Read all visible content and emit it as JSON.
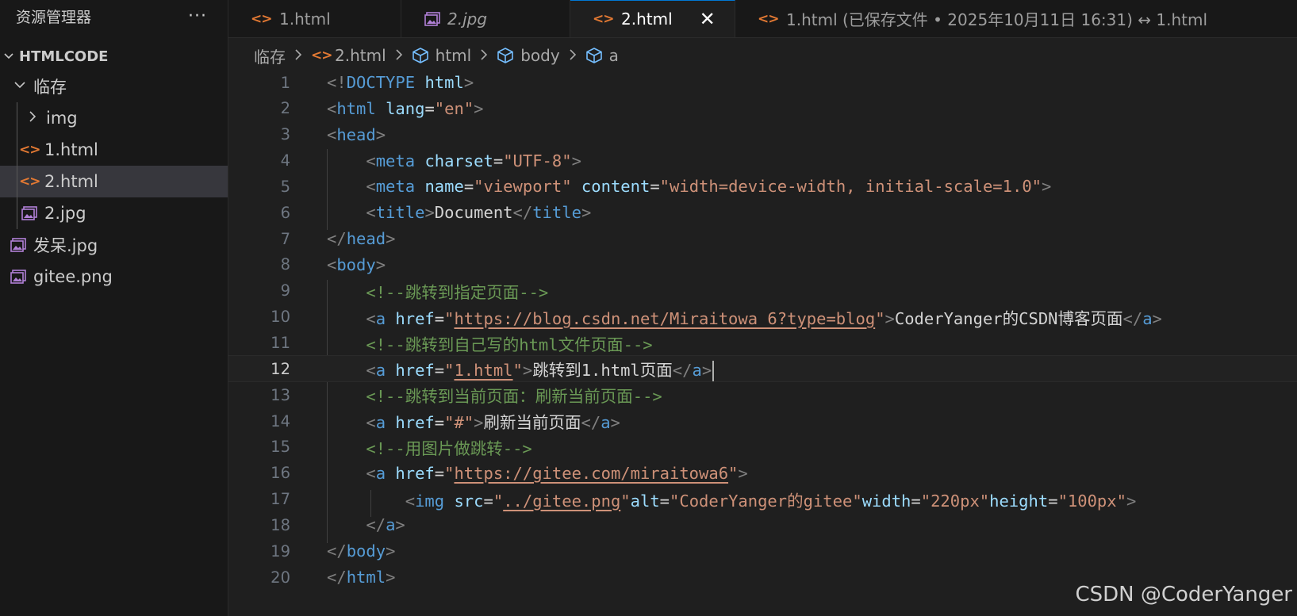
{
  "sidebar": {
    "title": "资源管理器",
    "more": "···",
    "root": "HTMLCODE",
    "items": [
      {
        "label": "临存",
        "kind": "folder-open"
      },
      {
        "label": "img",
        "kind": "folder"
      },
      {
        "label": "1.html",
        "kind": "html"
      },
      {
        "label": "2.html",
        "kind": "html",
        "selected": true
      },
      {
        "label": "2.jpg",
        "kind": "image"
      },
      {
        "label": "发呆.jpg",
        "kind": "image"
      },
      {
        "label": "gitee.png",
        "kind": "image"
      }
    ]
  },
  "tabs": [
    {
      "label": "1.html",
      "kind": "html"
    },
    {
      "label": "2.jpg",
      "kind": "image"
    },
    {
      "label": "2.html",
      "kind": "html",
      "active": true
    },
    {
      "label": "1.html (已保存文件 • 2025年10月11日 16:31) ↔ 1.html",
      "kind": "html"
    }
  ],
  "tab_close": "✕",
  "breadcrumb": [
    "临存",
    "2.html",
    "html",
    "body",
    "a"
  ],
  "code": {
    "current_line": 12,
    "line_numbers": [
      "1",
      "2",
      "3",
      "4",
      "5",
      "6",
      "7",
      "8",
      "9",
      "10",
      "11",
      "12",
      "13",
      "14",
      "15",
      "16",
      "17",
      "18",
      "19",
      "20"
    ],
    "lines": [
      [
        [
          "p",
          "<!"
        ],
        [
          "t",
          "DOCTYPE"
        ],
        [
          "x",
          " "
        ],
        [
          "a",
          "html"
        ],
        [
          "p",
          ">"
        ]
      ],
      [
        [
          "p",
          "<"
        ],
        [
          "t",
          "html"
        ],
        [
          "x",
          " "
        ],
        [
          "a",
          "lang"
        ],
        [
          "x",
          "="
        ],
        [
          "s",
          "\"en\""
        ],
        [
          "p",
          ">"
        ]
      ],
      [
        [
          "p",
          "<"
        ],
        [
          "t",
          "head"
        ],
        [
          "p",
          ">"
        ]
      ],
      [
        [
          "x",
          "    "
        ],
        [
          "p",
          "<"
        ],
        [
          "t",
          "meta"
        ],
        [
          "x",
          " "
        ],
        [
          "a",
          "charset"
        ],
        [
          "x",
          "="
        ],
        [
          "s",
          "\"UTF-8\""
        ],
        [
          "p",
          ">"
        ]
      ],
      [
        [
          "x",
          "    "
        ],
        [
          "p",
          "<"
        ],
        [
          "t",
          "meta"
        ],
        [
          "x",
          " "
        ],
        [
          "a",
          "name"
        ],
        [
          "x",
          "="
        ],
        [
          "s",
          "\"viewport\""
        ],
        [
          "x",
          " "
        ],
        [
          "a",
          "content"
        ],
        [
          "x",
          "="
        ],
        [
          "s",
          "\"width=device-width, initial-scale=1.0\""
        ],
        [
          "p",
          ">"
        ]
      ],
      [
        [
          "x",
          "    "
        ],
        [
          "p",
          "<"
        ],
        [
          "t",
          "title"
        ],
        [
          "p",
          ">"
        ],
        [
          "x",
          "Document"
        ],
        [
          "p",
          "</"
        ],
        [
          "t",
          "title"
        ],
        [
          "p",
          ">"
        ]
      ],
      [
        [
          "p",
          "</"
        ],
        [
          "t",
          "head"
        ],
        [
          "p",
          ">"
        ]
      ],
      [
        [
          "p",
          "<"
        ],
        [
          "t",
          "body"
        ],
        [
          "p",
          ">"
        ]
      ],
      [
        [
          "x",
          "    "
        ],
        [
          "c",
          "<!--跳转到指定页面-->"
        ]
      ],
      [
        [
          "x",
          "    "
        ],
        [
          "p",
          "<"
        ],
        [
          "t",
          "a"
        ],
        [
          "x",
          " "
        ],
        [
          "a",
          "href"
        ],
        [
          "x",
          "="
        ],
        [
          "s",
          "\""
        ],
        [
          "u",
          "https://blog.csdn.net/Miraitowa_6?type=blog"
        ],
        [
          "s",
          "\""
        ],
        [
          "p",
          ">"
        ],
        [
          "x",
          "CoderYanger的CSDN博客页面"
        ],
        [
          "p",
          "</"
        ],
        [
          "t",
          "a"
        ],
        [
          "p",
          ">"
        ]
      ],
      [
        [
          "x",
          "    "
        ],
        [
          "c",
          "<!--跳转到自己写的html文件页面-->"
        ]
      ],
      [
        [
          "x",
          "    "
        ],
        [
          "p",
          "<"
        ],
        [
          "t",
          "a"
        ],
        [
          "x",
          " "
        ],
        [
          "a",
          "href"
        ],
        [
          "x",
          "="
        ],
        [
          "s",
          "\""
        ],
        [
          "u",
          "1.html"
        ],
        [
          "s",
          "\""
        ],
        [
          "p",
          ">"
        ],
        [
          "x",
          "跳转到1.html页面"
        ],
        [
          "p",
          "</"
        ],
        [
          "t",
          "a"
        ],
        [
          "p",
          ">"
        ]
      ],
      [
        [
          "x",
          "    "
        ],
        [
          "c",
          "<!--跳转到当前页面：刷新当前页面-->"
        ]
      ],
      [
        [
          "x",
          "    "
        ],
        [
          "p",
          "<"
        ],
        [
          "t",
          "a"
        ],
        [
          "x",
          " "
        ],
        [
          "a",
          "href"
        ],
        [
          "x",
          "="
        ],
        [
          "s",
          "\"#\""
        ],
        [
          "p",
          ">"
        ],
        [
          "x",
          "刷新当前页面"
        ],
        [
          "p",
          "</"
        ],
        [
          "t",
          "a"
        ],
        [
          "p",
          ">"
        ]
      ],
      [
        [
          "x",
          "    "
        ],
        [
          "c",
          "<!--用图片做跳转-->"
        ]
      ],
      [
        [
          "x",
          "    "
        ],
        [
          "p",
          "<"
        ],
        [
          "t",
          "a"
        ],
        [
          "x",
          " "
        ],
        [
          "a",
          "href"
        ],
        [
          "x",
          "="
        ],
        [
          "s",
          "\""
        ],
        [
          "u",
          "https://gitee.com/miraitowa6"
        ],
        [
          "s",
          "\""
        ],
        [
          "p",
          ">"
        ]
      ],
      [
        [
          "x",
          "        "
        ],
        [
          "p",
          "<"
        ],
        [
          "t",
          "img"
        ],
        [
          "x",
          " "
        ],
        [
          "a",
          "src"
        ],
        [
          "x",
          "="
        ],
        [
          "s",
          "\""
        ],
        [
          "u",
          "../gitee.png"
        ],
        [
          "s",
          "\""
        ],
        [
          "a",
          "alt"
        ],
        [
          "x",
          "="
        ],
        [
          "s",
          "\"CoderYanger的gitee\""
        ],
        [
          "a",
          "width"
        ],
        [
          "x",
          "="
        ],
        [
          "s",
          "\"220px\""
        ],
        [
          "a",
          "height"
        ],
        [
          "x",
          "="
        ],
        [
          "s",
          "\"100px\""
        ],
        [
          "p",
          ">"
        ]
      ],
      [
        [
          "x",
          "    "
        ],
        [
          "p",
          "</"
        ],
        [
          "t",
          "a"
        ],
        [
          "p",
          ">"
        ]
      ],
      [
        [
          "p",
          "</"
        ],
        [
          "t",
          "body"
        ],
        [
          "p",
          ">"
        ]
      ],
      [
        [
          "p",
          "</"
        ],
        [
          "t",
          "html"
        ],
        [
          "p",
          ">"
        ]
      ]
    ]
  },
  "watermark": "CSDN @CoderYanger",
  "colors": {
    "html_icon": "#e37933",
    "image_icon": "#b180d7",
    "tag": "#569cd6",
    "attribute": "#9cdcfe",
    "string": "#ce9178",
    "comment": "#6a9955",
    "accent": "#0078d4"
  }
}
